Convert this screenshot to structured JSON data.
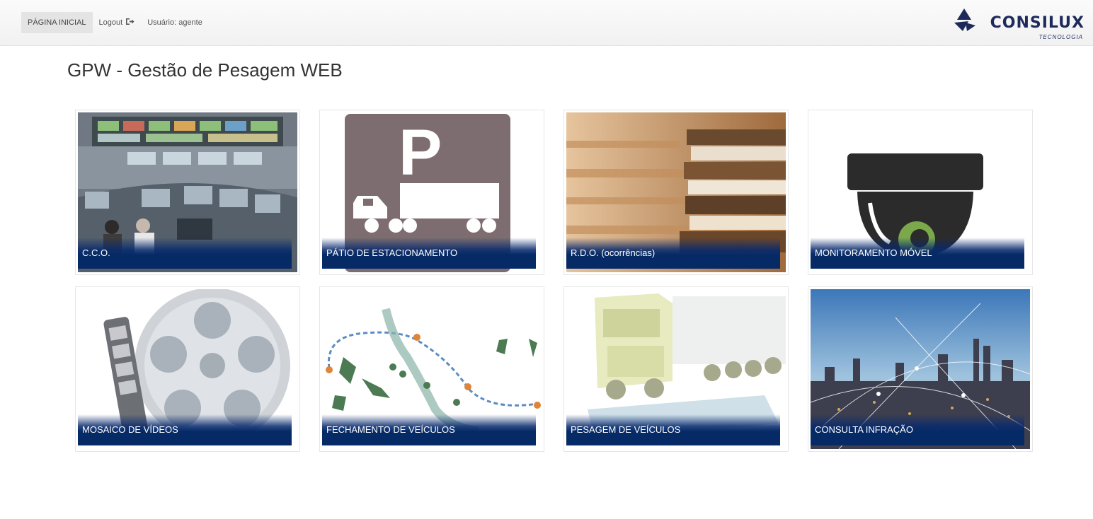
{
  "nav": {
    "home": "PÁGINA INICIAL",
    "logout": "Logout",
    "user": "Usuário: agente"
  },
  "brand": {
    "name": "CONSILUX",
    "tagline": "TECNOLOGIA",
    "color": "#1e2a5a"
  },
  "page": {
    "title": "GPW - Gestão de Pesagem WEB"
  },
  "tiles": [
    {
      "label": "C.C.O."
    },
    {
      "label": "PÁTIO DE ESTACIONAMENTO"
    },
    {
      "label": "R.D.O. (ocorrências)"
    },
    {
      "label": "MONITORAMENTO MÓVEL"
    },
    {
      "label": "MOSAICO DE VÍDEOS"
    },
    {
      "label": "FECHAMENTO DE VEÍCULOS"
    },
    {
      "label": "PESAGEM DE VEÍCULOS"
    },
    {
      "label": "CONSULTA INFRAÇÃO"
    }
  ],
  "colors": {
    "label_band": "#052a66",
    "navbar": "#f4f4f4"
  }
}
